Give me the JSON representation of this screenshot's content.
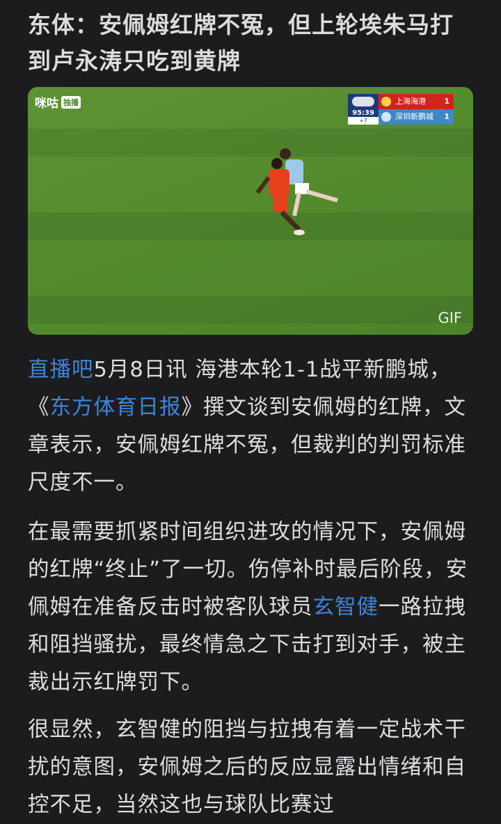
{
  "article": {
    "title": "东体：安佩姆红牌不冤，但上轮埃朱马打到卢永涛只吃到黄牌",
    "media": {
      "watermark": "咪咕",
      "watermark_badge": "独播",
      "gif_label": "GIF",
      "scoreboard": {
        "clock": "95:39",
        "added_time": "+7",
        "home_team": "上海海港",
        "home_score": "1",
        "away_team": "深圳新鹏城",
        "away_score": "1"
      }
    },
    "p1": {
      "source_link": "直播吧",
      "text_a": "5月8日讯 海港本轮1-1战平新鹏城，《",
      "paper_link": "东方体育日报",
      "text_b": "》撰文谈到安佩姆的红牌，文章表示，安佩姆红牌不冤，但裁判的判罚标准尺度不一。"
    },
    "p2": {
      "text_a": "在最需要抓紧时间组织进攻的情况下，安佩姆的红牌“终止”了一切。伤停补时最后阶段，安佩姆在准备反击时被客队球员",
      "player_link": "玄智健",
      "text_b": "一路拉拽和阻挡骚扰，最终情急之下击打到对手，被主裁出示红牌罚下。"
    },
    "p3": {
      "text": "很显然，玄智健的阻挡与拉拽有着一定战术干扰的意图，安佩姆之后的反应显露出情绪和自控不足，当然这也与球队比赛过"
    }
  },
  "colors": {
    "background": "#1c1c1e",
    "text": "#dedede",
    "link": "#3f84d8"
  }
}
